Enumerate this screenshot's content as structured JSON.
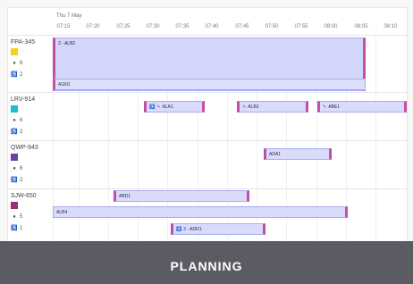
{
  "header": {
    "date": "Thu 7 May",
    "ticks": [
      "07:15",
      "07:20",
      "07:25",
      "07:30",
      "07:35",
      "07:40",
      "07:45",
      "07:50",
      "07:55",
      "08:00",
      "08:05",
      "08:10"
    ]
  },
  "rows": [
    {
      "id": "FPA-345",
      "color": "#f2d21b",
      "seats": "6",
      "wheelchair": "2",
      "bars": [
        {
          "label": "3 - ALB2"
        },
        {
          "label": "AGN1"
        }
      ]
    },
    {
      "id": "LRV-914",
      "color": "#19c1c8",
      "seats": "6",
      "wheelchair": "2",
      "bars": [
        {
          "label": "ALA1"
        },
        {
          "label": "ALB3"
        },
        {
          "label": "ABE1"
        }
      ]
    },
    {
      "id": "QWP-943",
      "color": "#6b3fa8",
      "seats": "6",
      "wheelchair": "2",
      "bars": [
        {
          "label": "ADA1"
        }
      ]
    },
    {
      "id": "SJW-650",
      "color": "#9a2a7a",
      "seats": "5",
      "wheelchair": "1",
      "bars": [
        {
          "label": "ABD1"
        },
        {
          "label": "ALB4"
        },
        {
          "label": "2 - ADR1"
        }
      ]
    }
  ],
  "footer": {
    "title": "PLANNING"
  }
}
